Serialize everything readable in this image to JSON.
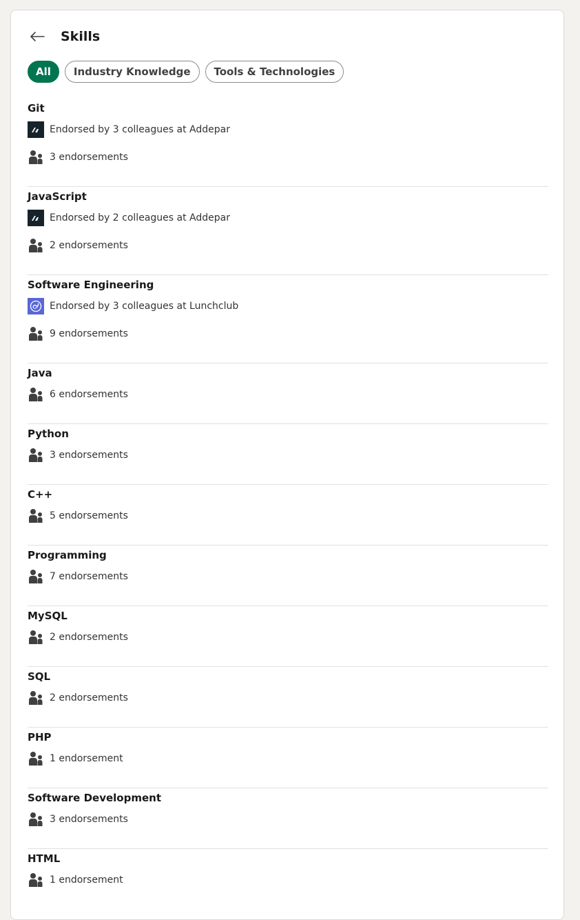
{
  "page": {
    "title": "Skills"
  },
  "filters": [
    {
      "label": "All",
      "active": true
    },
    {
      "label": "Industry Knowledge",
      "active": false
    },
    {
      "label": "Tools & Technologies",
      "active": false
    }
  ],
  "skills": [
    {
      "name": "Git",
      "company_text": "Endorsed by 3 colleagues at Addepar",
      "company_logo": "addepar-logo",
      "endorsements": "3 endorsements"
    },
    {
      "name": "JavaScript",
      "company_text": "Endorsed by 2 colleagues at Addepar",
      "company_logo": "addepar-logo",
      "endorsements": "2 endorsements"
    },
    {
      "name": "Software Engineering",
      "company_text": "Endorsed by 3 colleagues at Lunchclub",
      "company_logo": "lunchclub-logo",
      "endorsements": "9 endorsements"
    },
    {
      "name": "Java",
      "endorsements": "6 endorsements"
    },
    {
      "name": "Python",
      "endorsements": "3 endorsements"
    },
    {
      "name": "C++",
      "endorsements": "5 endorsements"
    },
    {
      "name": "Programming",
      "endorsements": "7 endorsements"
    },
    {
      "name": "MySQL",
      "endorsements": "2 endorsements"
    },
    {
      "name": "SQL",
      "endorsements": "2 endorsements"
    },
    {
      "name": "PHP",
      "endorsements": "1 endorsement"
    },
    {
      "name": "Software Development",
      "endorsements": "3 endorsements"
    },
    {
      "name": "HTML",
      "endorsements": "1 endorsement"
    }
  ],
  "icons": {
    "back": "arrow-left-icon",
    "people": "people-icon"
  },
  "colors": {
    "accent": "#01754f",
    "addepar_bg": "#16232a",
    "lunchclub_bg": "#5867d8"
  }
}
